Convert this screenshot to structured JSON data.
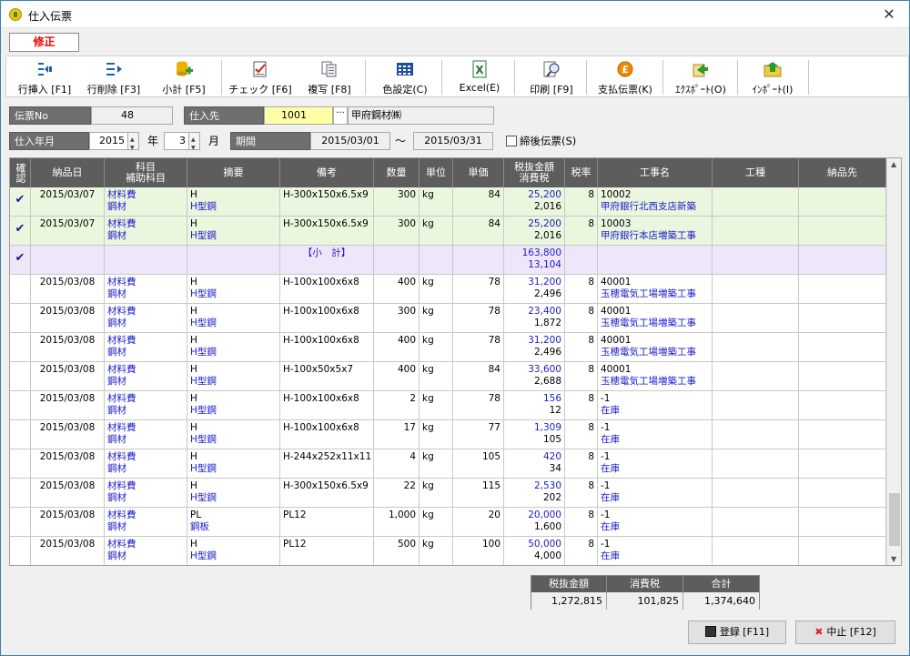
{
  "window": {
    "title": "仕入伝票"
  },
  "mode": "修正",
  "toolbar": {
    "row_insert": "行挿入 [F1]",
    "row_delete": "行削除 [F3]",
    "subtotal": "小計 [F5]",
    "check": "チェック [F6]",
    "copy": "複写 [F8]",
    "color": "色設定(C)",
    "excel": "Excel(E)",
    "print": "印刷 [F9]",
    "payment": "支払伝票(K)",
    "export": "ｴｸｽﾎﾟｰﾄ(O)",
    "import": "ｲﾝﾎﾟｰﾄ(I)"
  },
  "form": {
    "voucher_no_label": "伝票No",
    "voucher_no": "48",
    "supplier_label": "仕入先",
    "supplier_code": "1001",
    "supplier_name": "甲府鋼材㈱",
    "supplier_btn": "···",
    "ym_label": "仕入年月",
    "year": "2015",
    "year_unit": "年",
    "month": "3",
    "month_unit": "月",
    "period_label": "期間",
    "period_from": "2015/03/01",
    "period_sep": "～",
    "period_to": "2015/03/31",
    "closed_label": "締後伝票(S)"
  },
  "grid": {
    "headers": {
      "confirm": "確認",
      "date": "納品日",
      "subject": "科目",
      "subject2": "補助科目",
      "summary": "摘要",
      "note": "備考",
      "qty": "数量",
      "unit": "単位",
      "price": "単価",
      "amount": "税抜金額",
      "amount2": "消費税",
      "rate": "税率",
      "project": "工事名",
      "kind": "工種",
      "dest": "納品先"
    },
    "rows": [
      {
        "confirm": "✔",
        "date": "2015/03/07",
        "subj1": "材料費",
        "subj2": "鋼材",
        "sum1": "H",
        "sum2": "H型鋼",
        "note": "H-300x150x6.5x9",
        "qty": "300",
        "unit": "kg",
        "price": "84",
        "amt": "25,200",
        "tax": "2,016",
        "rate": "8",
        "proj1": "10002",
        "proj2": "甲府銀行北西支店新築",
        "kind": "",
        "dest": ""
      },
      {
        "confirm": "✔",
        "date": "2015/03/07",
        "subj1": "材料費",
        "subj2": "鋼材",
        "sum1": "H",
        "sum2": "H型鋼",
        "note": "H-300x150x6.5x9",
        "qty": "300",
        "unit": "kg",
        "price": "84",
        "amt": "25,200",
        "tax": "2,016",
        "rate": "8",
        "proj1": "10003",
        "proj2": "甲府銀行本店増築工事",
        "kind": "",
        "dest": ""
      },
      {
        "confirm": "✔",
        "date": "",
        "subj1": "",
        "subj2": "",
        "sum1": "",
        "sum2": "",
        "note": "【小　計】",
        "qty": "",
        "unit": "",
        "price": "",
        "amt": "163,800",
        "tax": "13,104",
        "rate": "",
        "proj1": "",
        "proj2": "",
        "kind": "",
        "dest": ""
      },
      {
        "confirm": "",
        "date": "2015/03/08",
        "subj1": "材料費",
        "subj2": "鋼材",
        "sum1": "H",
        "sum2": "H型鋼",
        "note": "H-100x100x6x8",
        "qty": "400",
        "unit": "kg",
        "price": "78",
        "amt": "31,200",
        "tax": "2,496",
        "rate": "8",
        "proj1": "40001",
        "proj2": "玉穂電気工場増築工事",
        "kind": "",
        "dest": ""
      },
      {
        "confirm": "",
        "date": "2015/03/08",
        "subj1": "材料費",
        "subj2": "鋼材",
        "sum1": "H",
        "sum2": "H型鋼",
        "note": "H-100x100x6x8",
        "qty": "300",
        "unit": "kg",
        "price": "78",
        "amt": "23,400",
        "tax": "1,872",
        "rate": "8",
        "proj1": "40001",
        "proj2": "玉穂電気工場増築工事",
        "kind": "",
        "dest": ""
      },
      {
        "confirm": "",
        "date": "2015/03/08",
        "subj1": "材料費",
        "subj2": "鋼材",
        "sum1": "H",
        "sum2": "H型鋼",
        "note": "H-100x100x6x8",
        "qty": "400",
        "unit": "kg",
        "price": "78",
        "amt": "31,200",
        "tax": "2,496",
        "rate": "8",
        "proj1": "40001",
        "proj2": "玉穂電気工場増築工事",
        "kind": "",
        "dest": ""
      },
      {
        "confirm": "",
        "date": "2015/03/08",
        "subj1": "材料費",
        "subj2": "鋼材",
        "sum1": "H",
        "sum2": "H型鋼",
        "note": "H-100x50x5x7",
        "qty": "400",
        "unit": "kg",
        "price": "84",
        "amt": "33,600",
        "tax": "2,688",
        "rate": "8",
        "proj1": "40001",
        "proj2": "玉穂電気工場増築工事",
        "kind": "",
        "dest": ""
      },
      {
        "confirm": "",
        "date": "2015/03/08",
        "subj1": "材料費",
        "subj2": "鋼材",
        "sum1": "H",
        "sum2": "H型鋼",
        "note": "H-100x100x6x8",
        "qty": "2",
        "unit": "kg",
        "price": "78",
        "amt": "156",
        "tax": "12",
        "rate": "8",
        "proj1": "-1",
        "proj2": "在庫",
        "kind": "",
        "dest": ""
      },
      {
        "confirm": "",
        "date": "2015/03/08",
        "subj1": "材料費",
        "subj2": "鋼材",
        "sum1": "H",
        "sum2": "H型鋼",
        "note": "H-100x100x6x8",
        "qty": "17",
        "unit": "kg",
        "price": "77",
        "amt": "1,309",
        "tax": "105",
        "rate": "8",
        "proj1": "-1",
        "proj2": "在庫",
        "kind": "",
        "dest": ""
      },
      {
        "confirm": "",
        "date": "2015/03/08",
        "subj1": "材料費",
        "subj2": "鋼材",
        "sum1": "H",
        "sum2": "H型鋼",
        "note": "H-244x252x11x11",
        "qty": "4",
        "unit": "kg",
        "price": "105",
        "amt": "420",
        "tax": "34",
        "rate": "8",
        "proj1": "-1",
        "proj2": "在庫",
        "kind": "",
        "dest": ""
      },
      {
        "confirm": "",
        "date": "2015/03/08",
        "subj1": "材料費",
        "subj2": "鋼材",
        "sum1": "H",
        "sum2": "H型鋼",
        "note": "H-300x150x6.5x9",
        "qty": "22",
        "unit": "kg",
        "price": "115",
        "amt": "2,530",
        "tax": "202",
        "rate": "8",
        "proj1": "-1",
        "proj2": "在庫",
        "kind": "",
        "dest": ""
      },
      {
        "confirm": "",
        "date": "2015/03/08",
        "subj1": "材料費",
        "subj2": "鋼材",
        "sum1": "PL",
        "sum2": "鋼板",
        "note": "PL12",
        "qty": "1,000",
        "unit": "kg",
        "price": "20",
        "amt": "20,000",
        "tax": "1,600",
        "rate": "8",
        "proj1": "-1",
        "proj2": "在庫",
        "kind": "",
        "dest": ""
      },
      {
        "confirm": "",
        "date": "2015/03/08",
        "subj1": "材料費",
        "subj2": "鋼材",
        "sum1": "H",
        "sum2": "H型鋼",
        "note": "PL12",
        "qty": "500",
        "unit": "kg",
        "price": "100",
        "amt": "50,000",
        "tax": "4,000",
        "rate": "8",
        "proj1": "-1",
        "proj2": "在庫",
        "kind": "",
        "dest": ""
      }
    ]
  },
  "totals": {
    "h1": "税抜金額",
    "h2": "消費税",
    "h3": "合計",
    "v1": "1,272,815",
    "v2": "101,825",
    "v3": "1,374,640"
  },
  "buttons": {
    "save": "登録 [F11]",
    "cancel": "中止 [F12]"
  },
  "colors": {
    "checked_row": "#eaf7de",
    "subtotal_row": "#efe6fa",
    "header": "#5d5d5d",
    "blue_text": "#1c1ccc"
  }
}
